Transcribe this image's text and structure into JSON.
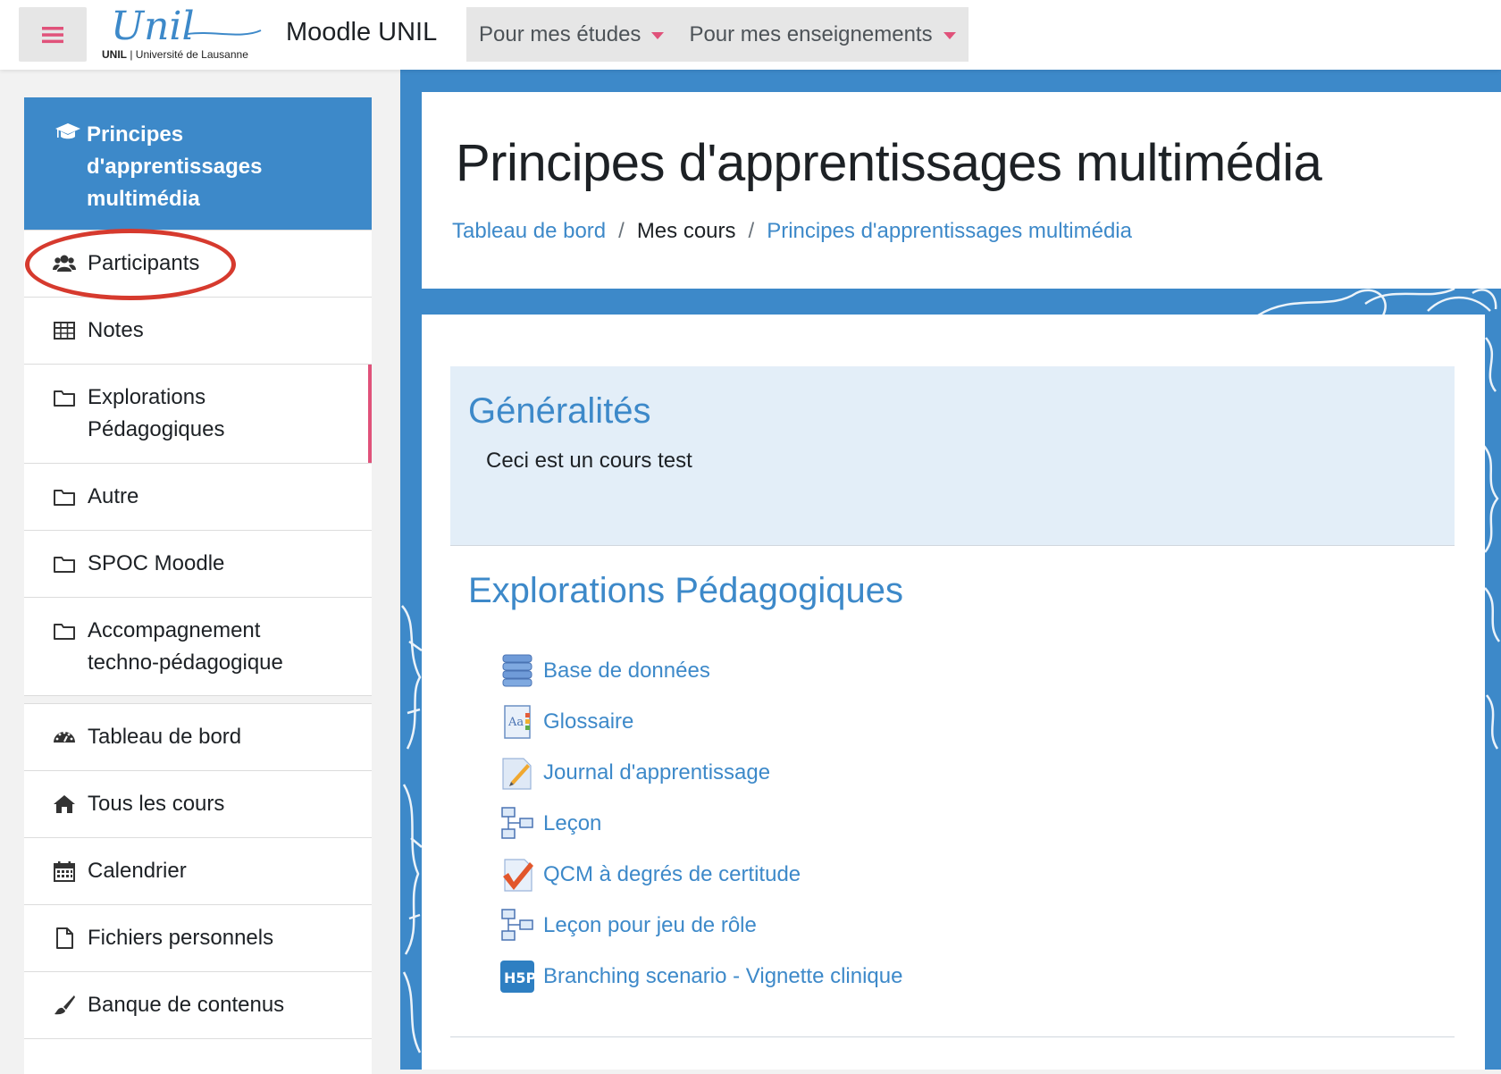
{
  "navbar": {
    "logo_text": "Unil",
    "logo_caption_bold": "UNIL",
    "logo_caption_rest": "| Université de Lausanne",
    "site_name": "Moodle UNIL",
    "menus": [
      {
        "label": "Pour mes études"
      },
      {
        "label": "Pour mes enseignements"
      }
    ]
  },
  "drawer": {
    "course_title": "Principes d'apprentissages multimédia",
    "course_items": [
      {
        "label": "Participants",
        "icon": "users-icon"
      },
      {
        "label": "Notes",
        "icon": "table-icon"
      },
      {
        "label": "Explorations Pédagogiques",
        "icon": "folder-icon"
      },
      {
        "label": "Autre",
        "icon": "folder-icon"
      },
      {
        "label": "SPOC Moodle",
        "icon": "folder-icon"
      },
      {
        "label": "Accompagnement techno-pédagogique",
        "icon": "folder-icon"
      }
    ],
    "site_items": [
      {
        "label": "Tableau de bord",
        "icon": "dashboard-icon"
      },
      {
        "label": "Tous les cours",
        "icon": "home-icon"
      },
      {
        "label": "Calendrier",
        "icon": "calendar-icon"
      },
      {
        "label": "Fichiers personnels",
        "icon": "file-icon"
      },
      {
        "label": "Banque de contenus",
        "icon": "paintbrush-icon"
      }
    ]
  },
  "header": {
    "title": "Principes d'apprentissages multimédia",
    "breadcrumb": [
      {
        "label": "Tableau de bord"
      },
      {
        "label": "Mes cours"
      },
      {
        "label": "Principes d'apprentissages multimédia"
      }
    ]
  },
  "sections": {
    "general": {
      "title": "Généralités",
      "summary": "Ceci est un cours test"
    },
    "explorations": {
      "title": "Explorations Pédagogiques",
      "activities": [
        {
          "label": "Base de données",
          "icon": "database-icon"
        },
        {
          "label": "Glossaire",
          "icon": "glossary-icon"
        },
        {
          "label": "Journal d'apprentissage",
          "icon": "journal-icon"
        },
        {
          "label": "Leçon",
          "icon": "lesson-icon"
        },
        {
          "label": "QCM à degrés de certitude",
          "icon": "quiz-icon"
        },
        {
          "label": "Leçon pour jeu de rôle",
          "icon": "lesson-icon"
        },
        {
          "label": "Branching scenario - Vignette clinique",
          "icon": "h5p-icon"
        }
      ]
    }
  },
  "colors": {
    "brand": "#3d89c9",
    "accent": "#e0527a",
    "annotation": "#d63a2e"
  }
}
